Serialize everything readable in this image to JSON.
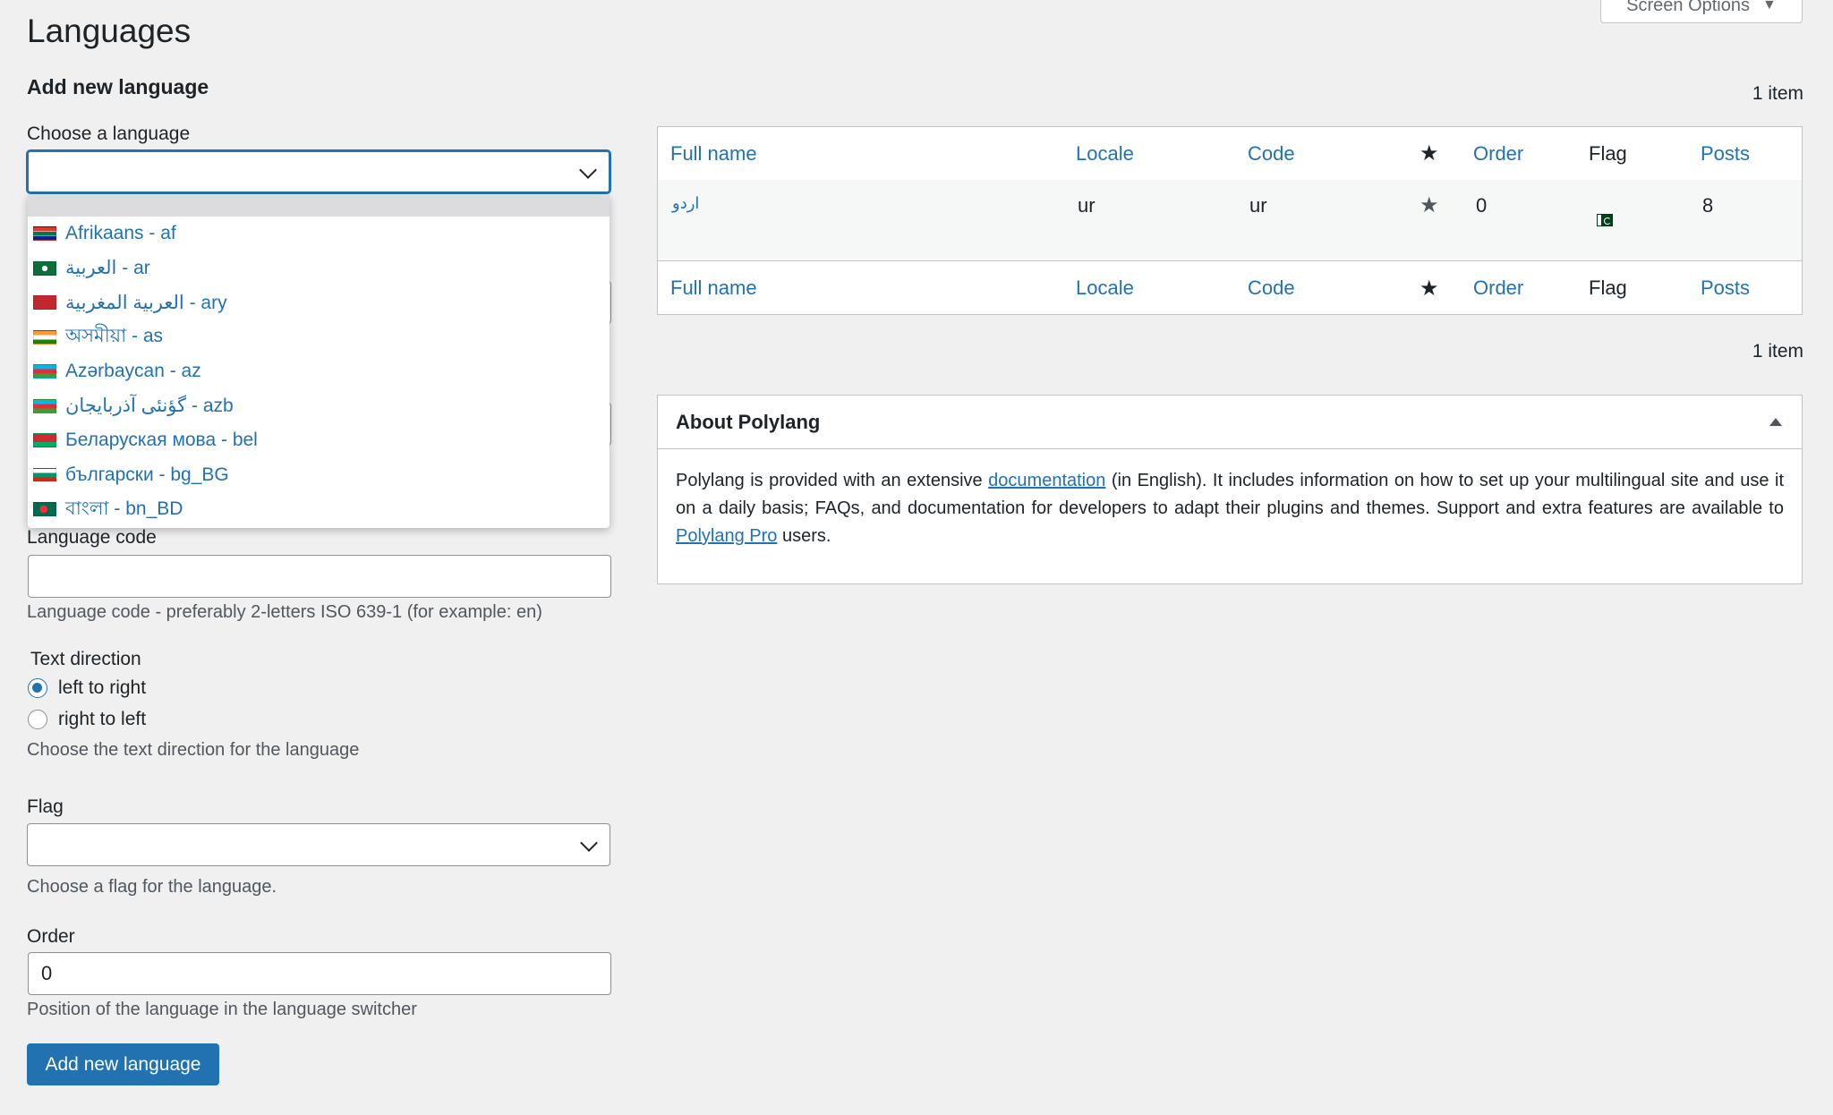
{
  "page": {
    "title": "Languages",
    "screen_options_label": "Screen Options"
  },
  "form": {
    "section_title": "Add new language",
    "choose_label": "Choose a language",
    "dropdown_items": [
      {
        "label": "Afrikaans - af",
        "flag": "za"
      },
      {
        "label": "العربية - ar",
        "flag": "arab"
      },
      {
        "label": "العربية المغربية - ary",
        "flag": "ma"
      },
      {
        "label": "অসমীয়া - as",
        "flag": "in"
      },
      {
        "label": "Azərbaycan - az",
        "flag": "az"
      },
      {
        "label": "گؤنئی آذربایجان - azb",
        "flag": "az"
      },
      {
        "label": "Беларуская мова - bel",
        "flag": "by"
      },
      {
        "label": "български - bg_BG",
        "flag": "bg"
      },
      {
        "label": "বাংলা - bn_BD",
        "flag": "bd"
      }
    ],
    "code_label": "Language code",
    "code_value": "",
    "code_desc": "Language code - preferably 2-letters ISO 639-1 (for example: en)",
    "direction_label": "Text direction",
    "direction_options": [
      {
        "label": "left to right",
        "checked": true
      },
      {
        "label": "right to left",
        "checked": false
      }
    ],
    "direction_desc": "Choose the text direction for the language",
    "flag_label": "Flag",
    "flag_desc": "Choose a flag for the language.",
    "order_label": "Order",
    "order_value": "0",
    "order_desc": "Position of the language in the language switcher",
    "submit_label": "Add new language"
  },
  "table": {
    "items_count": "1 item",
    "columns": {
      "full_name": "Full name",
      "locale": "Locale",
      "code": "Code",
      "order": "Order",
      "flag": "Flag",
      "posts": "Posts"
    },
    "row": {
      "full_name": "اردو",
      "locale": "ur",
      "code": "ur",
      "order": "0",
      "flag": "pk",
      "posts": "8"
    }
  },
  "about": {
    "title": "About Polylang",
    "text_1": "Polylang is provided with an extensive ",
    "link_doc": "documentation",
    "text_2": " (in English). It includes information on how to set up your multilingual site and use it on a daily basis; FAQs, and documentation for developers to adapt their plugins and themes. Support and extra features are available to ",
    "link_pro": "Polylang Pro",
    "text_3": " users."
  },
  "colors": {
    "accent": "#2271b1",
    "text": "#1d2327",
    "background": "#f0f0f1",
    "border": "#c3c4c7"
  }
}
